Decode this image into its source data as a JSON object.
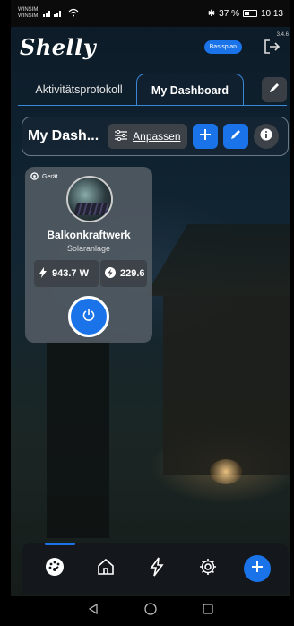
{
  "status_bar": {
    "carrier_line1": "WINSIM",
    "carrier_line2": "WINSIM",
    "battery": "37 %",
    "time": "10:13"
  },
  "header": {
    "logo": "Shelly",
    "plan_badge": "Basisplan",
    "version": "3.4.6"
  },
  "tabs": [
    {
      "label": "Aktivitätsprotokoll"
    },
    {
      "label": "My Dashboard",
      "active": true
    }
  ],
  "dashboard": {
    "title": "My Dash...",
    "customize_label": "Anpassen"
  },
  "device_card": {
    "type_label": "Gerät",
    "name": "Balkonkraftwerk",
    "subtitle": "Solaranlage",
    "power": "943.7 W",
    "energy": "229.6"
  },
  "bottom_nav": {
    "items": [
      "dashboard-icon",
      "home-icon",
      "bolt-icon",
      "gear-icon",
      "plus-icon"
    ],
    "active_index": 0
  },
  "colors": {
    "accent": "#1a73e8",
    "card": "#565e66"
  }
}
